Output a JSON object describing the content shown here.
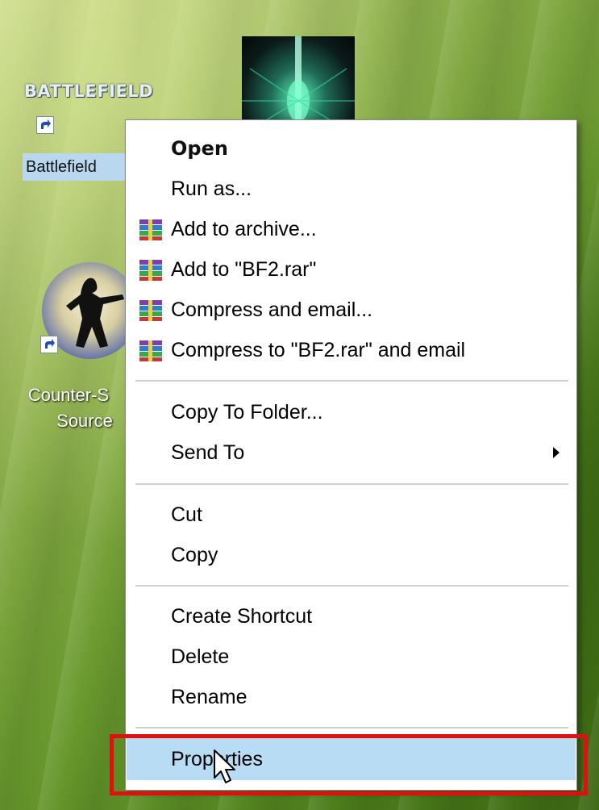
{
  "desktop": {
    "icons": [
      {
        "label": "Battlefield",
        "logo_text": "BATTLEFIELD",
        "icon": "battlefield-icon",
        "selected": true
      },
      {
        "label": "Counter-Strike Source",
        "icon": "counter-strike-icon",
        "label_lines": [
          "Counter-S",
          "Source"
        ]
      },
      {
        "label": "",
        "icon": "game-thumbnail-icon"
      }
    ]
  },
  "context_menu": {
    "groups": [
      [
        {
          "label": "Open",
          "bold": true
        },
        {
          "label": "Run as..."
        },
        {
          "label": "Add to archive...",
          "icon": "winrar-icon"
        },
        {
          "label": "Add to \"BF2.rar\"",
          "icon": "winrar-icon"
        },
        {
          "label": "Compress and email...",
          "icon": "winrar-icon"
        },
        {
          "label": "Compress to \"BF2.rar\" and email",
          "icon": "winrar-icon"
        }
      ],
      [
        {
          "label": "Copy To Folder..."
        },
        {
          "label": "Send To",
          "submenu": true
        }
      ],
      [
        {
          "label": "Cut"
        },
        {
          "label": "Copy"
        }
      ],
      [
        {
          "label": "Create Shortcut"
        },
        {
          "label": "Delete"
        },
        {
          "label": "Rename"
        }
      ],
      [
        {
          "label": "Properties",
          "highlighted": true
        }
      ]
    ]
  },
  "annotation": {
    "highlight_color": "#e01010",
    "target": "Properties"
  },
  "colors": {
    "selection_bg": "#b9d8f0",
    "menu_highlight": "#b7dcf3"
  }
}
